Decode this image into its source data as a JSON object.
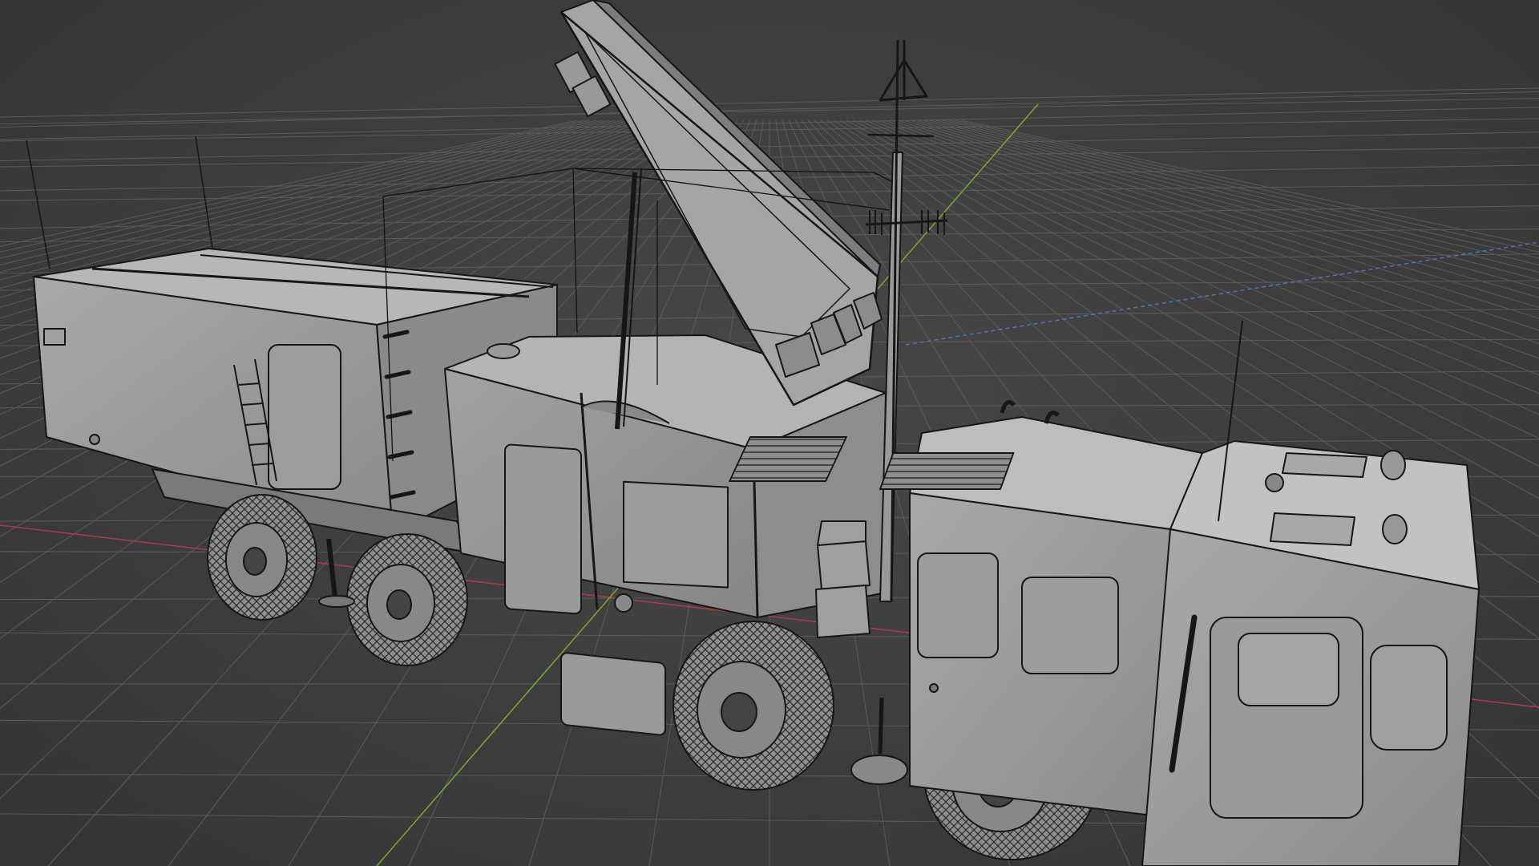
{
  "viewport": {
    "mode": "3d-viewport",
    "shading": "solid-wireframe-overlay",
    "colors": {
      "background": "#3d3d3d",
      "grid": "#5a5a5a",
      "x_axis": "#b03a48",
      "y_axis": "#7fa82b",
      "z_axis_dashed": "#4a78b0",
      "mesh_fill": "#9a9a9a",
      "mesh_fill_light": "#b3b3b3",
      "mesh_fill_dark": "#7a7a7a",
      "edge": "#1a1a1a"
    }
  },
  "model": {
    "object_type": "military-radar-truck",
    "icons": [
      "radar-truck-mesh",
      "radar-antenna-panel",
      "mast-antenna",
      "wheel-mesh",
      "cabin-mesh",
      "equipment-shelter-mesh"
    ]
  }
}
